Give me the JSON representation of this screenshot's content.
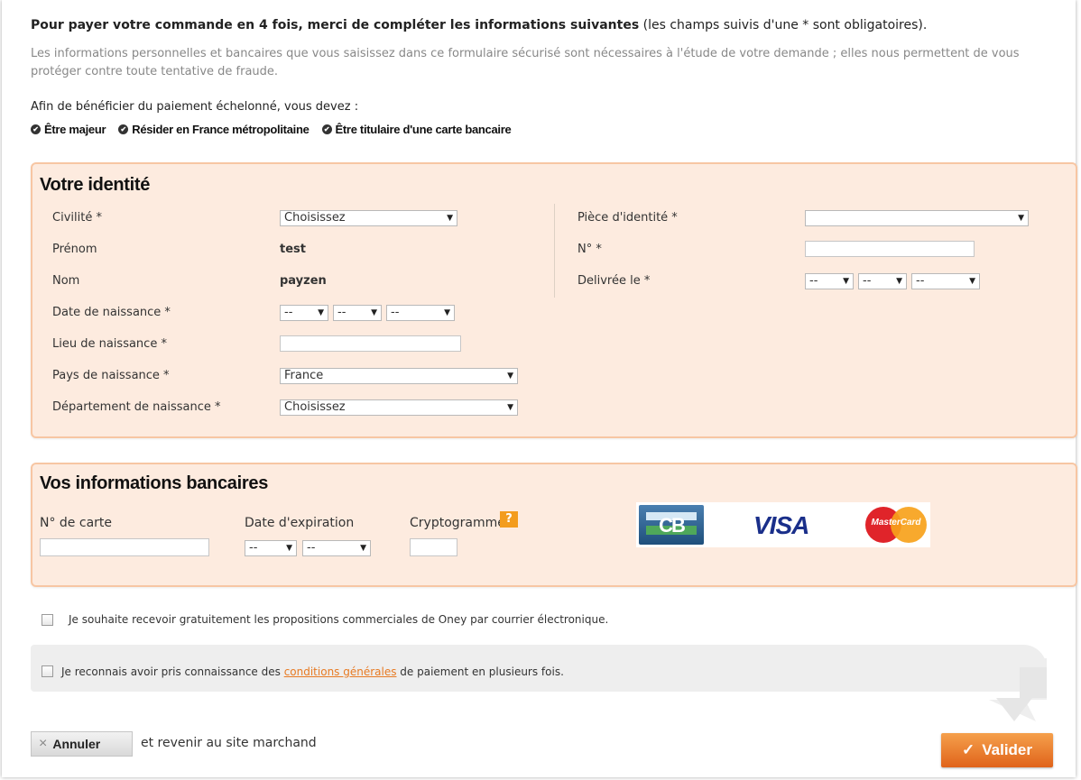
{
  "intro": {
    "title_bold": "Pour payer votre commande en 4 fois, merci de compléter les informations suivantes",
    "title_rest": " (les champs suivis d'une * sont obligatoires).",
    "description": "Les informations personnelles et bancaires que vous saisissez dans ce formulaire sécurisé sont nécessaires à l'étude de votre demande ; elles nous permettent de vous protéger contre toute tentative de fraude.",
    "conditions_title": "Afin de bénéficier du paiement échelonné, vous devez :",
    "conditions": [
      "Être majeur",
      "Résider en France métropolitaine",
      "Être titulaire d'une carte bancaire"
    ]
  },
  "identity": {
    "title": "Votre identité",
    "civilite_label": "Civilité *",
    "civilite_value": "Choisissez",
    "prenom_label": "Prénom",
    "prenom_value": "test",
    "nom_label": "Nom",
    "nom_value": "payzen",
    "dob_label": "Date de naissance *",
    "dob_day": "--",
    "dob_month": "--",
    "dob_year": "--",
    "birthplace_label": "Lieu de naissance *",
    "birthplace_value": "",
    "birthcountry_label": "Pays de naissance *",
    "birthcountry_value": "France",
    "birthdept_label": "Département de naissance *",
    "birthdept_value": "Choisissez",
    "id_doc_label": "Pièce d'identité *",
    "id_doc_value": "",
    "id_number_label": "N° *",
    "id_number_value": "",
    "issued_label": "Delivrée le *",
    "issued_day": "--",
    "issued_month": "--",
    "issued_year": "--"
  },
  "bank": {
    "title": "Vos informations bancaires",
    "card_number_label": "N° de carte",
    "card_number_value": "",
    "expiry_label": "Date d'expiration",
    "expiry_month": "--",
    "expiry_year": "--",
    "cvv_label": "Cryptogramme",
    "cvv_value": "",
    "help_icon": "?",
    "card_logos": {
      "cb": "CB",
      "visa": "VISA",
      "mastercard": "MasterCard"
    }
  },
  "checkboxes": {
    "newsletter": "Je souhaite recevoir gratuitement les propositions commerciales de Oney par courrier électronique.",
    "terms_before": "Je reconnais avoir pris connaissance des ",
    "terms_link": "conditions générales",
    "terms_after": " de paiement en plusieurs fois."
  },
  "actions": {
    "cancel_label": "Annuler",
    "cancel_icon": "×",
    "cancel_suffix": "et revenir au site marchand",
    "validate_label": "Valider",
    "validate_icon": "✓"
  },
  "colors": {
    "accent": "#e77a23",
    "box_bg": "#fdebdf",
    "box_border": "#f7c6a3"
  }
}
